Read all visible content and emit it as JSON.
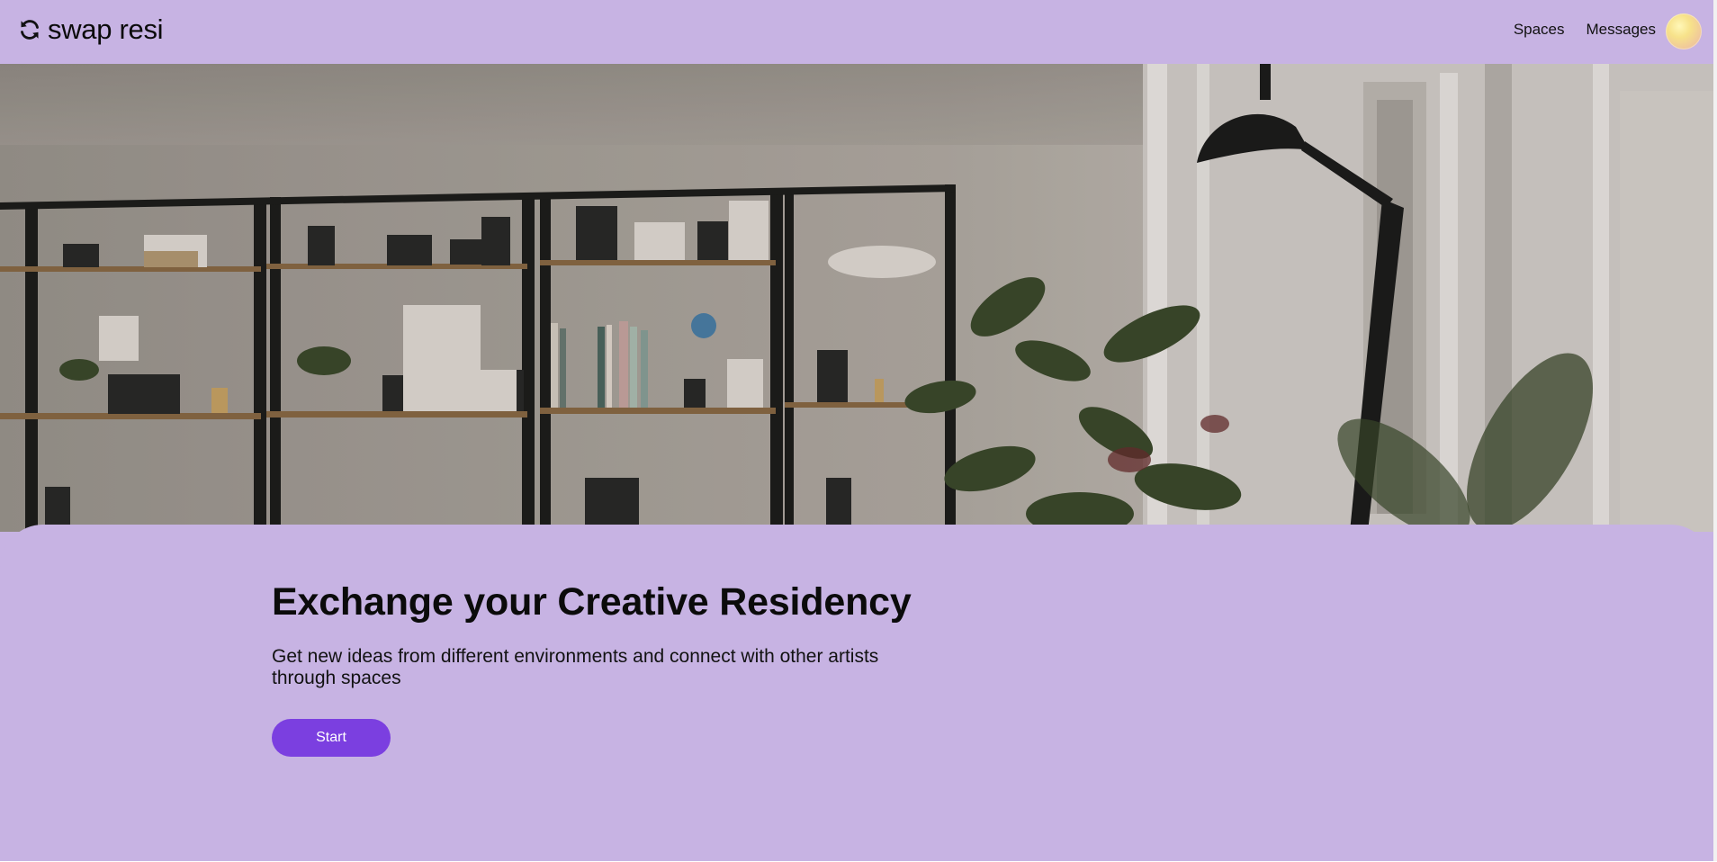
{
  "header": {
    "logo_text": "swap resi",
    "logo_icon": "refresh-icon",
    "nav": [
      {
        "label": "Spaces"
      },
      {
        "label": "Messages"
      }
    ],
    "avatar_icon": "user-avatar"
  },
  "hero": {
    "image_subject": "shelves-with-cameras-and-plants-photo"
  },
  "main": {
    "title": "Exchange your Creative Residency",
    "subtitle": "Get new ideas from different environments and connect with other artists through spaces",
    "start_label": "Start"
  },
  "colors": {
    "background": "#c7b3e3",
    "button": "#7b3fe0",
    "button_text": "#ffffff",
    "text": "#0b0b0b"
  }
}
